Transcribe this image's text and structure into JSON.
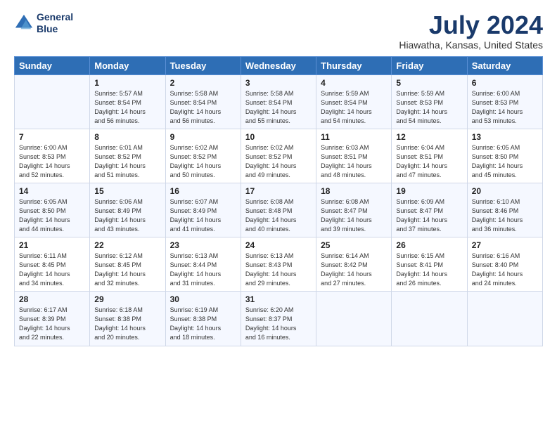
{
  "header": {
    "logo_line1": "General",
    "logo_line2": "Blue",
    "title": "July 2024",
    "subtitle": "Hiawatha, Kansas, United States"
  },
  "calendar": {
    "headers": [
      "Sunday",
      "Monday",
      "Tuesday",
      "Wednesday",
      "Thursday",
      "Friday",
      "Saturday"
    ],
    "weeks": [
      [
        {
          "date": "",
          "info": ""
        },
        {
          "date": "1",
          "info": "Sunrise: 5:57 AM\nSunset: 8:54 PM\nDaylight: 14 hours\nand 56 minutes."
        },
        {
          "date": "2",
          "info": "Sunrise: 5:58 AM\nSunset: 8:54 PM\nDaylight: 14 hours\nand 56 minutes."
        },
        {
          "date": "3",
          "info": "Sunrise: 5:58 AM\nSunset: 8:54 PM\nDaylight: 14 hours\nand 55 minutes."
        },
        {
          "date": "4",
          "info": "Sunrise: 5:59 AM\nSunset: 8:54 PM\nDaylight: 14 hours\nand 54 minutes."
        },
        {
          "date": "5",
          "info": "Sunrise: 5:59 AM\nSunset: 8:53 PM\nDaylight: 14 hours\nand 54 minutes."
        },
        {
          "date": "6",
          "info": "Sunrise: 6:00 AM\nSunset: 8:53 PM\nDaylight: 14 hours\nand 53 minutes."
        }
      ],
      [
        {
          "date": "7",
          "info": "Sunrise: 6:00 AM\nSunset: 8:53 PM\nDaylight: 14 hours\nand 52 minutes."
        },
        {
          "date": "8",
          "info": "Sunrise: 6:01 AM\nSunset: 8:52 PM\nDaylight: 14 hours\nand 51 minutes."
        },
        {
          "date": "9",
          "info": "Sunrise: 6:02 AM\nSunset: 8:52 PM\nDaylight: 14 hours\nand 50 minutes."
        },
        {
          "date": "10",
          "info": "Sunrise: 6:02 AM\nSunset: 8:52 PM\nDaylight: 14 hours\nand 49 minutes."
        },
        {
          "date": "11",
          "info": "Sunrise: 6:03 AM\nSunset: 8:51 PM\nDaylight: 14 hours\nand 48 minutes."
        },
        {
          "date": "12",
          "info": "Sunrise: 6:04 AM\nSunset: 8:51 PM\nDaylight: 14 hours\nand 47 minutes."
        },
        {
          "date": "13",
          "info": "Sunrise: 6:05 AM\nSunset: 8:50 PM\nDaylight: 14 hours\nand 45 minutes."
        }
      ],
      [
        {
          "date": "14",
          "info": "Sunrise: 6:05 AM\nSunset: 8:50 PM\nDaylight: 14 hours\nand 44 minutes."
        },
        {
          "date": "15",
          "info": "Sunrise: 6:06 AM\nSunset: 8:49 PM\nDaylight: 14 hours\nand 43 minutes."
        },
        {
          "date": "16",
          "info": "Sunrise: 6:07 AM\nSunset: 8:49 PM\nDaylight: 14 hours\nand 41 minutes."
        },
        {
          "date": "17",
          "info": "Sunrise: 6:08 AM\nSunset: 8:48 PM\nDaylight: 14 hours\nand 40 minutes."
        },
        {
          "date": "18",
          "info": "Sunrise: 6:08 AM\nSunset: 8:47 PM\nDaylight: 14 hours\nand 39 minutes."
        },
        {
          "date": "19",
          "info": "Sunrise: 6:09 AM\nSunset: 8:47 PM\nDaylight: 14 hours\nand 37 minutes."
        },
        {
          "date": "20",
          "info": "Sunrise: 6:10 AM\nSunset: 8:46 PM\nDaylight: 14 hours\nand 36 minutes."
        }
      ],
      [
        {
          "date": "21",
          "info": "Sunrise: 6:11 AM\nSunset: 8:45 PM\nDaylight: 14 hours\nand 34 minutes."
        },
        {
          "date": "22",
          "info": "Sunrise: 6:12 AM\nSunset: 8:45 PM\nDaylight: 14 hours\nand 32 minutes."
        },
        {
          "date": "23",
          "info": "Sunrise: 6:13 AM\nSunset: 8:44 PM\nDaylight: 14 hours\nand 31 minutes."
        },
        {
          "date": "24",
          "info": "Sunrise: 6:13 AM\nSunset: 8:43 PM\nDaylight: 14 hours\nand 29 minutes."
        },
        {
          "date": "25",
          "info": "Sunrise: 6:14 AM\nSunset: 8:42 PM\nDaylight: 14 hours\nand 27 minutes."
        },
        {
          "date": "26",
          "info": "Sunrise: 6:15 AM\nSunset: 8:41 PM\nDaylight: 14 hours\nand 26 minutes."
        },
        {
          "date": "27",
          "info": "Sunrise: 6:16 AM\nSunset: 8:40 PM\nDaylight: 14 hours\nand 24 minutes."
        }
      ],
      [
        {
          "date": "28",
          "info": "Sunrise: 6:17 AM\nSunset: 8:39 PM\nDaylight: 14 hours\nand 22 minutes."
        },
        {
          "date": "29",
          "info": "Sunrise: 6:18 AM\nSunset: 8:38 PM\nDaylight: 14 hours\nand 20 minutes."
        },
        {
          "date": "30",
          "info": "Sunrise: 6:19 AM\nSunset: 8:38 PM\nDaylight: 14 hours\nand 18 minutes."
        },
        {
          "date": "31",
          "info": "Sunrise: 6:20 AM\nSunset: 8:37 PM\nDaylight: 14 hours\nand 16 minutes."
        },
        {
          "date": "",
          "info": ""
        },
        {
          "date": "",
          "info": ""
        },
        {
          "date": "",
          "info": ""
        }
      ]
    ]
  }
}
